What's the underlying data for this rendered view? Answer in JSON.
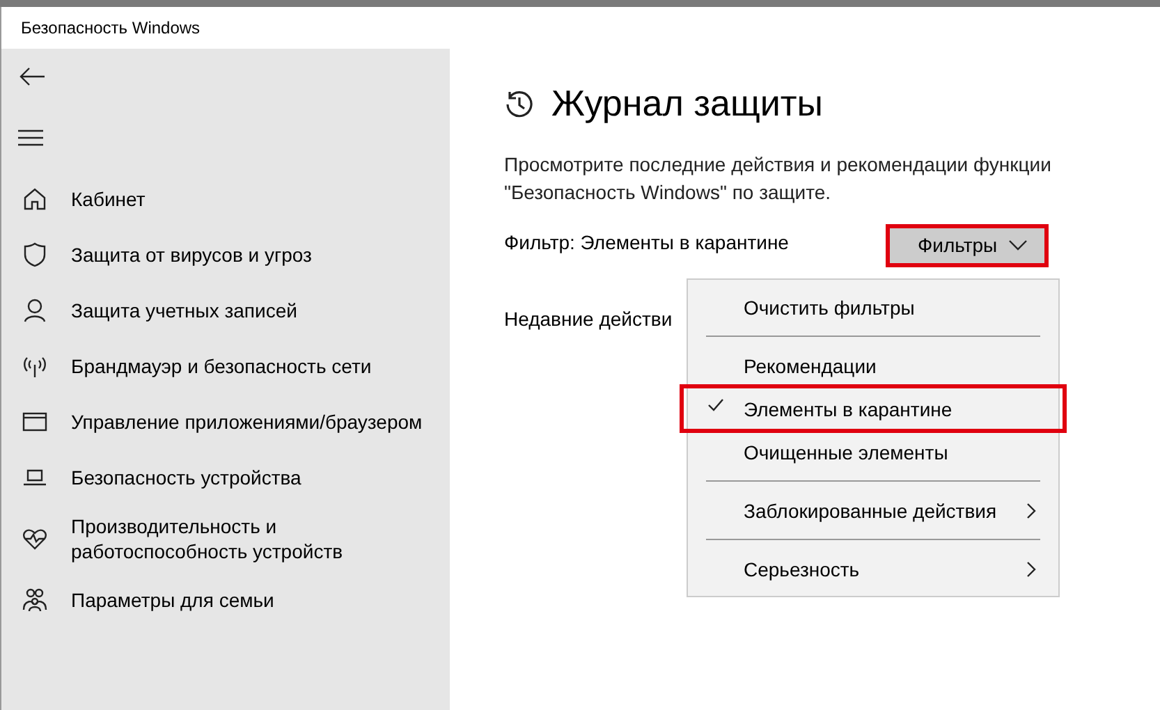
{
  "window": {
    "title": "Безопасность Windows"
  },
  "sidebar": {
    "items": [
      {
        "label": "Кабинет"
      },
      {
        "label": "Защита от вирусов и угроз"
      },
      {
        "label": "Защита учетных записей"
      },
      {
        "label": "Брандмауэр и безопасность сети"
      },
      {
        "label": "Управление приложениями/браузером"
      },
      {
        "label": "Безопасность устройства"
      },
      {
        "label": "Производительность и работоспособность устройств"
      },
      {
        "label": "Параметры для семьи"
      }
    ]
  },
  "page": {
    "title": "Журнал защиты",
    "description": "Просмотрите последние действия и рекомендации функции \"Безопасность Windows\" по защите.",
    "filter_label": "Фильтр: Элементы в карантине",
    "filter_button": {
      "label": "Фильтры",
      "highlighted": true
    },
    "recent_label": "Недавние действи"
  },
  "menu": {
    "groups": [
      [
        {
          "label": "Очистить фильтры",
          "checked": false,
          "submenu": false,
          "highlighted": false
        }
      ],
      [
        {
          "label": "Рекомендации",
          "checked": false,
          "submenu": false,
          "highlighted": false
        },
        {
          "label": "Элементы в карантине",
          "checked": true,
          "submenu": false,
          "highlighted": true
        },
        {
          "label": "Очищенные элементы",
          "checked": false,
          "submenu": false,
          "highlighted": false
        }
      ],
      [
        {
          "label": "Заблокированные действия",
          "checked": false,
          "submenu": true,
          "highlighted": false
        }
      ],
      [
        {
          "label": "Серьезность",
          "checked": false,
          "submenu": true,
          "highlighted": false
        }
      ]
    ]
  }
}
